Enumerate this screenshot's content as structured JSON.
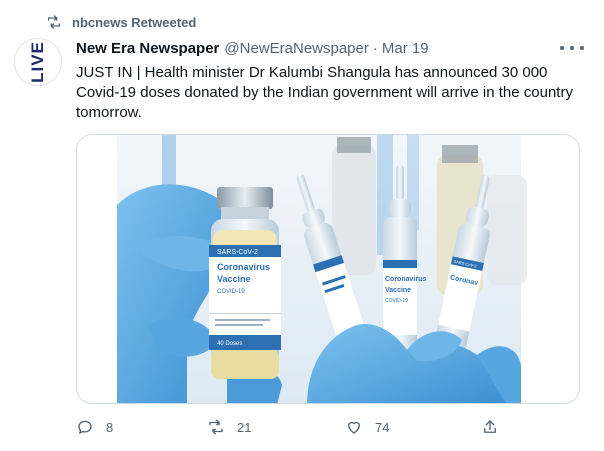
{
  "retweet": {
    "label": "nbcnews Retweeted",
    "icon": "retweet-icon"
  },
  "tweet": {
    "display_name": "New Era Newspaper",
    "handle": "@NewEraNewspaper",
    "separator": "·",
    "date": "Mar 19",
    "text": "JUST IN | Health minister Dr Kalumbi Shangula has announced 30 000 Covid-19 doses donated by the Indian government will arrive in the country tomorrow.",
    "avatar_text": "LIVE"
  },
  "media": {
    "vial_label_1": "SARS-CoV-2",
    "vial_label_2": "Coronavirus",
    "vial_label_3": "Vaccine",
    "vial_label_4": "COVID-19",
    "vial_label_5": "40 Doses",
    "ampoule_label_1": "Coronavirus",
    "ampoule_label_2": "Vaccine",
    "ampoule_label_3": "COVID-19",
    "ampoule_label_4": "Coronav",
    "ampoule_label_5": "SARS-CoV-2"
  },
  "actions": {
    "replies": "8",
    "retweets": "21",
    "likes": "74"
  },
  "colors": {
    "text": "#0f1419",
    "muted": "#536471",
    "border": "#cfd9de",
    "glove": "#4a9bd8"
  }
}
